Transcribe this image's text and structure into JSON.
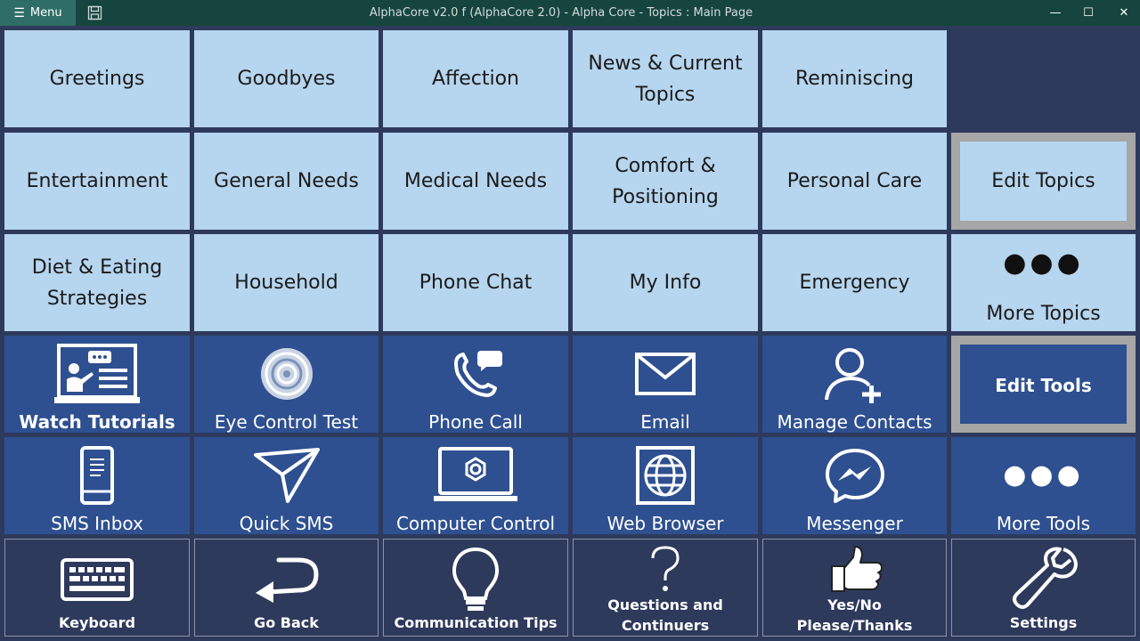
{
  "window": {
    "menu_label": "Menu",
    "title": "AlphaCore v2.0 f (AlphaCore 2.0) - Alpha Core - Topics : Main Page",
    "minimize": "—",
    "maximize": "☐",
    "close": "✕"
  },
  "topics": {
    "greetings": "Greetings",
    "goodbyes": "Goodbyes",
    "affection": "Affection",
    "news_line1": "News & Current",
    "news_line2": "Topics",
    "reminiscing": "Reminiscing",
    "entertainment": "Entertainment",
    "general_needs": "General Needs",
    "medical_needs": "Medical Needs",
    "comfort_line1": "Comfort &",
    "comfort_line2": "Positioning",
    "personal_care": "Personal Care",
    "edit_topics": "Edit Topics",
    "diet_line1": "Diet & Eating",
    "diet_line2": "Strategies",
    "household": "Household",
    "phone_chat": "Phone Chat",
    "my_info": "My Info",
    "emergency": "Emergency",
    "more_topics": "More Topics",
    "more_dots": "●●●"
  },
  "tools": {
    "watch_tutorials": "Watch Tutorials",
    "eye_control_test": "Eye Control Test",
    "phone_call": "Phone Call",
    "email": "Email",
    "manage_contacts": "Manage Contacts",
    "edit_tools": "Edit Tools",
    "sms_inbox": "SMS Inbox",
    "quick_sms": "Quick SMS",
    "computer_control": "Computer Control",
    "web_browser": "Web Browser",
    "messenger": "Messenger",
    "more_tools": "More Tools",
    "more_dots": "●●●"
  },
  "bottom": {
    "keyboard": "Keyboard",
    "go_back": "Go Back",
    "communication_tips": "Communication Tips",
    "questions_line1": "Questions and",
    "questions_line2": "Continuers",
    "yesno_line1": "Yes/No",
    "yesno_line2": "Please/Thanks",
    "settings": "Settings"
  },
  "colors": {
    "topic_tile": "#b6d5ee",
    "tool_tile": "#2e5090",
    "bottom_tile": "#2e3a5c",
    "title_bar": "#16453f",
    "menu_button": "#2f6e66",
    "edit_frame": "#a6a6a6"
  }
}
